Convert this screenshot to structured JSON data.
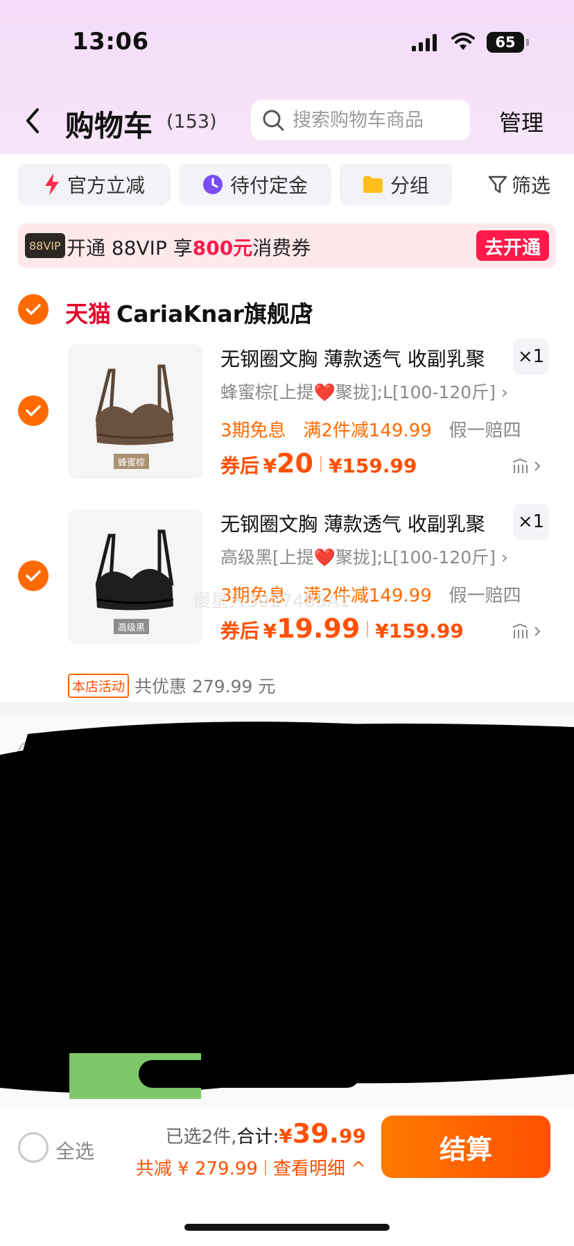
{
  "status_bar": {
    "time": "13:06",
    "battery": "65"
  },
  "header": {
    "title": "购物车",
    "count": "(153)",
    "search_placeholder": "搜索购物车商品",
    "manage_label": "管理"
  },
  "filters": [
    {
      "label": "官方立减",
      "icon": "flash-icon"
    },
    {
      "label": "待付定金",
      "icon": "clock-icon"
    },
    {
      "label": "分组",
      "icon": "folder-icon"
    }
  ],
  "filter_button_label": "筛选",
  "vip_banner": {
    "badge": "88VIP",
    "text_prefix": "开通 88VIP 享",
    "highlight": "800元",
    "text_suffix": "消费券",
    "button_label": "去开通"
  },
  "store": {
    "platform": "天猫",
    "name": "CariaKnar旗舰店",
    "items": [
      {
        "title": "无钢圈文胸 薄款透气 收副乳聚",
        "qty": "×1",
        "sku": "蜂蜜棕[上提❤️聚拢];L[100-120斤]",
        "image_tag": "蜂蜜棕",
        "promo1": "3期免息",
        "promo2": "满2件减149.99",
        "promo3": "假一赔四",
        "coupon_label": "券后",
        "currency": "¥",
        "coupon_price": "20",
        "original_price": "¥159.99"
      },
      {
        "title": "无钢圈文胸 薄款透气 收副乳聚",
        "qty": "×1",
        "sku": "高级黑[上提❤️聚拢];L[100-120斤]",
        "image_tag": "高级黑",
        "promo1": "3期免息",
        "promo2": "满2件减149.99",
        "promo3": "假一赔四",
        "coupon_label": "券后",
        "currency": "¥",
        "coupon_price": "19.99",
        "original_price": "¥159.99"
      }
    ],
    "promo_tag": "本店活动",
    "promo_text": "共优惠 279.99 元"
  },
  "watermark": "慢星人3927485A1",
  "bottom_bar": {
    "select_all_label": "全选",
    "selected_text": "已选2件,",
    "total_label": "合计:",
    "currency": "¥",
    "total_int": "39.",
    "total_dec": "99",
    "discount_text": "共减 ¥ 279.99",
    "details_label": "查看明细 ^",
    "checkout_label": "结算"
  },
  "colors": {
    "accent": "#ff5000",
    "tmall": "#e4002b",
    "vip": "#ff1a4b",
    "header_bg": "#f3dbf7"
  }
}
